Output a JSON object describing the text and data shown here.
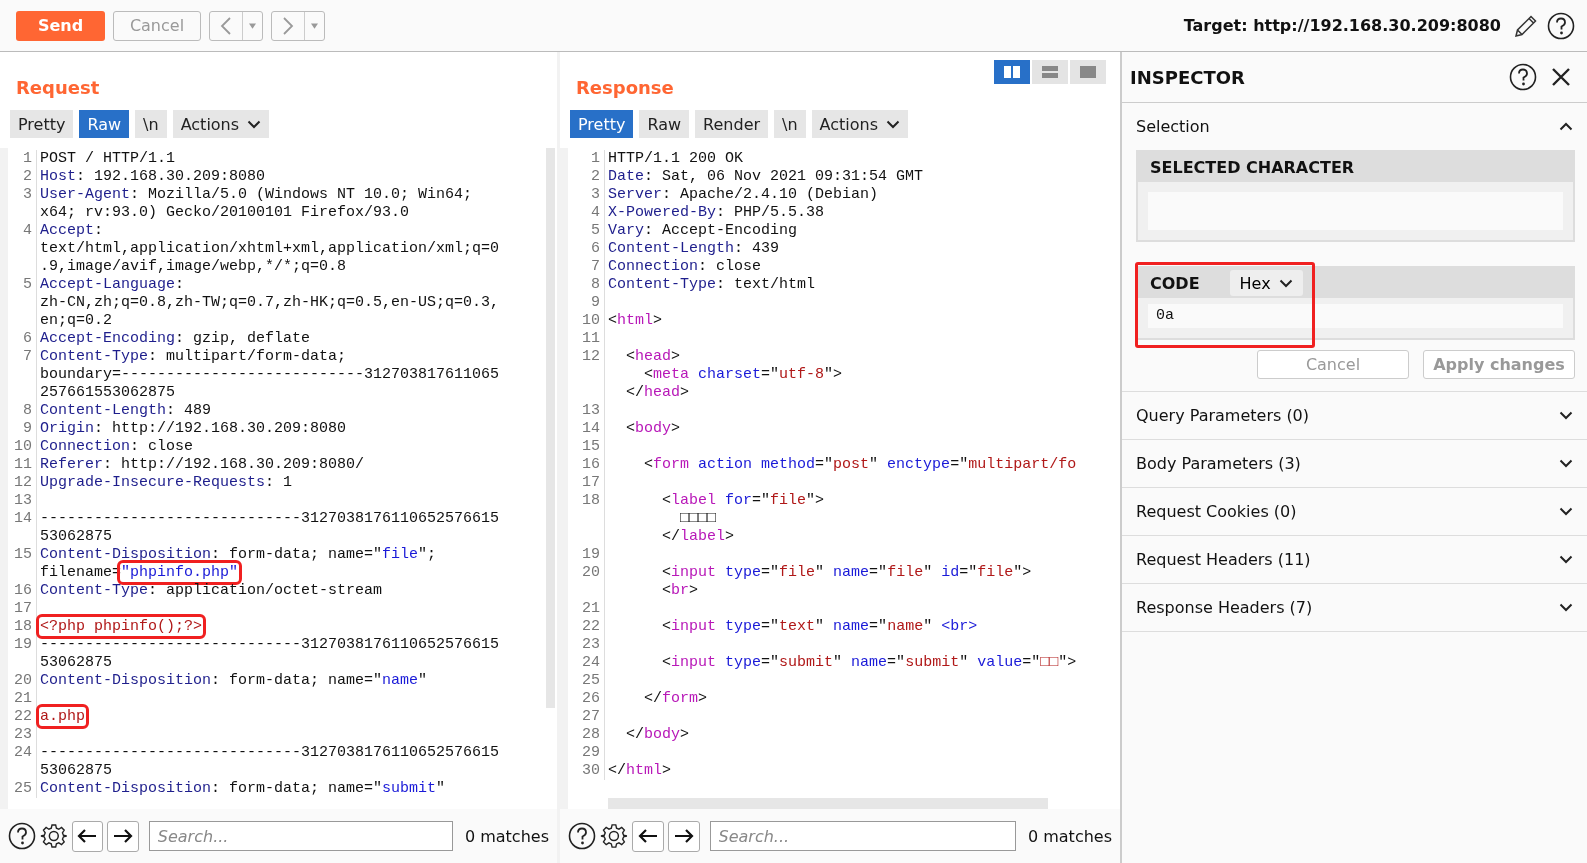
{
  "toolbar": {
    "send": "Send",
    "cancel": {
      "label": "Cancel",
      "disabled": true
    },
    "target": "Target: http://192.168.30.209:8080"
  },
  "request": {
    "title": "Request",
    "tabs": [
      {
        "label": "Pretty",
        "kind": "tab",
        "selected": false
      },
      {
        "label": "Raw",
        "kind": "tab",
        "selected": true
      },
      {
        "label": "\\n",
        "kind": "tab",
        "selected": false
      },
      {
        "label": "Actions",
        "kind": "menu",
        "selected": false
      }
    ],
    "lines": [
      {
        "num": "1",
        "rows": [
          [
            {
              "text": "POST / HTTP/1.1",
              "kind": "p"
            }
          ]
        ]
      },
      {
        "num": "2",
        "rows": [
          [
            {
              "text": "Host",
              "kind": "k"
            },
            {
              "text": ": 192.168.30.209:8080",
              "kind": "p"
            }
          ]
        ]
      },
      {
        "num": "3",
        "rows": [
          [
            {
              "text": "User-Agent",
              "kind": "k"
            },
            {
              "text": ": Mozilla/5.0 (Windows NT 10.0; Win64;",
              "kind": "p"
            }
          ],
          [
            {
              "text": "x64; rv:93.0) Gecko/20100101 Firefox/93.0",
              "kind": "p"
            }
          ]
        ]
      },
      {
        "num": "4",
        "rows": [
          [
            {
              "text": "Accept",
              "kind": "k"
            },
            {
              "text": ":",
              "kind": "p"
            }
          ],
          [
            {
              "text": "text/html,application/xhtml+xml,application/xml;q=0",
              "kind": "p"
            }
          ],
          [
            {
              "text": ".9,image/avif,image/webp,*/*;q=0.8",
              "kind": "p"
            }
          ]
        ]
      },
      {
        "num": "5",
        "rows": [
          [
            {
              "text": "Accept-Language",
              "kind": "k"
            },
            {
              "text": ":",
              "kind": "p"
            }
          ],
          [
            {
              "text": "zh-CN,zh;q=0.8,zh-TW;q=0.7,zh-HK;q=0.5,en-US;q=0.3,",
              "kind": "p"
            }
          ],
          [
            {
              "text": "en;q=0.2",
              "kind": "p"
            }
          ]
        ]
      },
      {
        "num": "6",
        "rows": [
          [
            {
              "text": "Accept-Encoding",
              "kind": "k"
            },
            {
              "text": ": gzip, deflate",
              "kind": "p"
            }
          ]
        ]
      },
      {
        "num": "7",
        "rows": [
          [
            {
              "text": "Content-Type",
              "kind": "k"
            },
            {
              "text": ": multipart/form-data;",
              "kind": "p"
            }
          ],
          [
            {
              "text": "boundary=---------------------------312703817611065",
              "kind": "p"
            }
          ],
          [
            {
              "text": "257661553062875",
              "kind": "p"
            }
          ]
        ]
      },
      {
        "num": "8",
        "rows": [
          [
            {
              "text": "Content-Length",
              "kind": "k"
            },
            {
              "text": ": 489",
              "kind": "p"
            }
          ]
        ]
      },
      {
        "num": "9",
        "rows": [
          [
            {
              "text": "Origin",
              "kind": "k"
            },
            {
              "text": ": http://192.168.30.209:8080",
              "kind": "p"
            }
          ]
        ]
      },
      {
        "num": "10",
        "rows": [
          [
            {
              "text": "Connection",
              "kind": "k"
            },
            {
              "text": ": close",
              "kind": "p"
            }
          ]
        ]
      },
      {
        "num": "11",
        "rows": [
          [
            {
              "text": "Referer",
              "kind": "k"
            },
            {
              "text": ": http://192.168.30.209:8080/",
              "kind": "p"
            }
          ]
        ]
      },
      {
        "num": "12",
        "rows": [
          [
            {
              "text": "Upgrade-Insecure-Requests",
              "kind": "k"
            },
            {
              "text": ": 1",
              "kind": "p"
            }
          ]
        ]
      },
      {
        "num": "13",
        "rows": [
          []
        ]
      },
      {
        "num": "14",
        "rows": [
          [
            {
              "text": "-----------------------------3127038176110652576615",
              "kind": "p"
            }
          ],
          [
            {
              "text": "53062875",
              "kind": "p"
            }
          ]
        ]
      },
      {
        "num": "15",
        "rows": [
          [
            {
              "text": "Content-Disposition",
              "kind": "k"
            },
            {
              "text": ": form-data; name=\"",
              "kind": "p"
            },
            {
              "text": "file",
              "kind": "a"
            },
            {
              "text": "\";",
              "kind": "p"
            }
          ],
          [
            {
              "text": "filename=",
              "kind": "p"
            },
            {
              "text": "\"phpinfo.php\"",
              "kind": "a",
              "boxed": true
            }
          ]
        ]
      },
      {
        "num": "16",
        "rows": [
          [
            {
              "text": "Content-Type",
              "kind": "k"
            },
            {
              "text": ": application/octet-stream",
              "kind": "p"
            }
          ]
        ]
      },
      {
        "num": "17",
        "rows": [
          []
        ]
      },
      {
        "num": "18",
        "rows": [
          [
            {
              "text": "<?php phpinfo();?>",
              "kind": "v",
              "boxed": true
            }
          ]
        ]
      },
      {
        "num": "19",
        "rows": [
          [
            {
              "text": "-----------------------------3127038176110652576615",
              "kind": "p"
            }
          ],
          [
            {
              "text": "53062875",
              "kind": "p"
            }
          ]
        ]
      },
      {
        "num": "20",
        "rows": [
          [
            {
              "text": "Content-Disposition",
              "kind": "k"
            },
            {
              "text": ": form-data; name=\"",
              "kind": "p"
            },
            {
              "text": "name",
              "kind": "a"
            },
            {
              "text": "\"",
              "kind": "p"
            }
          ]
        ]
      },
      {
        "num": "21",
        "rows": [
          []
        ]
      },
      {
        "num": "22",
        "rows": [
          [
            {
              "text": "a.php",
              "kind": "v",
              "boxed": true
            }
          ]
        ]
      },
      {
        "num": "23",
        "rows": [
          []
        ]
      },
      {
        "num": "24",
        "rows": [
          [
            {
              "text": "-----------------------------3127038176110652576615",
              "kind": "p"
            }
          ],
          [
            {
              "text": "53062875",
              "kind": "p"
            }
          ]
        ]
      },
      {
        "num": "25",
        "rows": [
          [
            {
              "text": "Content-Disposition",
              "kind": "k"
            },
            {
              "text": ": form-data; name=\"",
              "kind": "p"
            },
            {
              "text": "submit",
              "kind": "a"
            },
            {
              "text": "\"",
              "kind": "p"
            }
          ]
        ]
      }
    ],
    "search": {
      "placeholder": "Search...",
      "matches": "0 matches"
    }
  },
  "response": {
    "title": "Response",
    "layout_buttons": [
      {
        "kind": "columns",
        "selected": true
      },
      {
        "kind": "rows",
        "selected": false
      },
      {
        "kind": "single",
        "selected": false
      }
    ],
    "tabs": [
      {
        "label": "Pretty",
        "kind": "tab",
        "selected": true
      },
      {
        "label": "Raw",
        "kind": "tab",
        "selected": false
      },
      {
        "label": "Render",
        "kind": "tab",
        "selected": false
      },
      {
        "label": "\\n",
        "kind": "tab",
        "selected": false
      },
      {
        "label": "Actions",
        "kind": "menu",
        "selected": false
      }
    ],
    "lines": [
      {
        "num": "1",
        "rows": [
          [
            {
              "text": "HTTP/1.1 200 OK",
              "kind": "p"
            }
          ]
        ]
      },
      {
        "num": "2",
        "rows": [
          [
            {
              "text": "Date",
              "kind": "k"
            },
            {
              "text": ": Sat, 06 Nov 2021 09:31:54 GMT",
              "kind": "p"
            }
          ]
        ]
      },
      {
        "num": "3",
        "rows": [
          [
            {
              "text": "Server",
              "kind": "k"
            },
            {
              "text": ": Apache/2.4.10 (Debian)",
              "kind": "p"
            }
          ]
        ]
      },
      {
        "num": "4",
        "rows": [
          [
            {
              "text": "X-Powered-By",
              "kind": "k"
            },
            {
              "text": ": PHP/5.5.38",
              "kind": "p"
            }
          ]
        ]
      },
      {
        "num": "5",
        "rows": [
          [
            {
              "text": "Vary",
              "kind": "k"
            },
            {
              "text": ": Accept-Encoding",
              "kind": "p"
            }
          ]
        ]
      },
      {
        "num": "6",
        "rows": [
          [
            {
              "text": "Content-Length",
              "kind": "k"
            },
            {
              "text": ": 439",
              "kind": "p"
            }
          ]
        ]
      },
      {
        "num": "7",
        "rows": [
          [
            {
              "text": "Connection",
              "kind": "k"
            },
            {
              "text": ": close",
              "kind": "p"
            }
          ]
        ]
      },
      {
        "num": "8",
        "rows": [
          [
            {
              "text": "Content-Type",
              "kind": "k"
            },
            {
              "text": ": text/html",
              "kind": "p"
            }
          ]
        ]
      },
      {
        "num": "9",
        "rows": [
          []
        ]
      },
      {
        "num": "10",
        "rows": [
          [
            {
              "text": "<",
              "kind": "p"
            },
            {
              "text": "html",
              "kind": "t"
            },
            {
              "text": ">",
              "kind": "p"
            }
          ]
        ]
      },
      {
        "num": "11",
        "rows": [
          []
        ]
      },
      {
        "num": "12",
        "rows": [
          {
            "spans": [
              {
                "text": "  <",
                "kind": "p"
              },
              {
                "text": "head",
                "kind": "t"
              },
              {
                "text": ">",
                "kind": "p"
              }
            ]
          },
          {
            "spans": [
              {
                "text": "    <",
                "kind": "p"
              },
              {
                "text": "meta ",
                "kind": "t"
              },
              {
                "text": "charset",
                "kind": "a"
              },
              {
                "text": "=\"",
                "kind": "p"
              },
              {
                "text": "utf-8",
                "kind": "v"
              },
              {
                "text": "\">",
                "kind": "p"
              }
            ]
          },
          {
            "spans": [
              {
                "text": "  </",
                "kind": "p"
              },
              {
                "text": "head",
                "kind": "t"
              },
              {
                "text": ">",
                "kind": "p"
              }
            ]
          }
        ]
      },
      {
        "num": "13",
        "rows": [
          []
        ]
      },
      {
        "num": "14",
        "rows": [
          [
            {
              "text": "  <",
              "kind": "p"
            },
            {
              "text": "body",
              "kind": "t"
            },
            {
              "text": ">",
              "kind": "p"
            }
          ]
        ]
      },
      {
        "num": "15",
        "rows": [
          []
        ]
      },
      {
        "num": "16",
        "rows": [
          [
            {
              "text": "    <",
              "kind": "p"
            },
            {
              "text": "form ",
              "kind": "t"
            },
            {
              "text": "action ",
              "kind": "a"
            },
            {
              "text": "method",
              "kind": "a"
            },
            {
              "text": "=\"",
              "kind": "p"
            },
            {
              "text": "post",
              "kind": "v"
            },
            {
              "text": "\" ",
              "kind": "p"
            },
            {
              "text": "enctype",
              "kind": "a"
            },
            {
              "text": "=\"",
              "kind": "p"
            },
            {
              "text": "multipart/fo",
              "kind": "v"
            }
          ]
        ]
      },
      {
        "num": "17",
        "rows": [
          []
        ]
      },
      {
        "num": "18",
        "rows": [
          {
            "spans": [
              {
                "text": "      <",
                "kind": "p"
              },
              {
                "text": "label ",
                "kind": "t"
              },
              {
                "text": "for",
                "kind": "a"
              },
              {
                "text": "=\"",
                "kind": "p"
              },
              {
                "text": "file",
                "kind": "v"
              },
              {
                "text": "\">",
                "kind": "p"
              }
            ]
          },
          {
            "spans": [
              {
                "text": "        □□□□",
                "kind": "p"
              }
            ]
          },
          {
            "spans": [
              {
                "text": "      </",
                "kind": "p"
              },
              {
                "text": "label",
                "kind": "t"
              },
              {
                "text": ">",
                "kind": "p"
              }
            ]
          }
        ]
      },
      {
        "num": "19",
        "rows": [
          []
        ]
      },
      {
        "num": "20",
        "rows": [
          {
            "spans": [
              {
                "text": "      <",
                "kind": "p"
              },
              {
                "text": "input ",
                "kind": "t"
              },
              {
                "text": "type",
                "kind": "a"
              },
              {
                "text": "=\"",
                "kind": "p"
              },
              {
                "text": "file",
                "kind": "v"
              },
              {
                "text": "\" ",
                "kind": "p"
              },
              {
                "text": "name",
                "kind": "a"
              },
              {
                "text": "=\"",
                "kind": "p"
              },
              {
                "text": "file",
                "kind": "v"
              },
              {
                "text": "\" ",
                "kind": "p"
              },
              {
                "text": "id",
                "kind": "a"
              },
              {
                "text": "=\"",
                "kind": "p"
              },
              {
                "text": "file",
                "kind": "v"
              },
              {
                "text": "\">",
                "kind": "p"
              }
            ]
          },
          {
            "spans": [
              {
                "text": "      <",
                "kind": "p"
              },
              {
                "text": "br",
                "kind": "t"
              },
              {
                "text": ">",
                "kind": "p"
              }
            ]
          }
        ]
      },
      {
        "num": "21",
        "rows": [
          []
        ]
      },
      {
        "num": "22",
        "rows": [
          [
            {
              "text": "      <",
              "kind": "p"
            },
            {
              "text": "input ",
              "kind": "t"
            },
            {
              "text": "type",
              "kind": "a"
            },
            {
              "text": "=\"",
              "kind": "p"
            },
            {
              "text": "text",
              "kind": "v"
            },
            {
              "text": "\" ",
              "kind": "p"
            },
            {
              "text": "name",
              "kind": "a"
            },
            {
              "text": "=\"",
              "kind": "p"
            },
            {
              "text": "name",
              "kind": "v"
            },
            {
              "text": "\" ",
              "kind": "p"
            },
            {
              "text": "<br>",
              "kind": "a"
            }
          ]
        ]
      },
      {
        "num": "23",
        "rows": [
          []
        ]
      },
      {
        "num": "24",
        "rows": [
          [
            {
              "text": "      <",
              "kind": "p"
            },
            {
              "text": "input ",
              "kind": "t"
            },
            {
              "text": "type",
              "kind": "a"
            },
            {
              "text": "=\"",
              "kind": "p"
            },
            {
              "text": "submit",
              "kind": "v"
            },
            {
              "text": "\" ",
              "kind": "p"
            },
            {
              "text": "name",
              "kind": "a"
            },
            {
              "text": "=\"",
              "kind": "p"
            },
            {
              "text": "submit",
              "kind": "v"
            },
            {
              "text": "\" ",
              "kind": "p"
            },
            {
              "text": "value",
              "kind": "a"
            },
            {
              "text": "=\"",
              "kind": "p"
            },
            {
              "text": "□□",
              "kind": "v"
            },
            {
              "text": "\">",
              "kind": "p"
            }
          ]
        ]
      },
      {
        "num": "25",
        "rows": [
          []
        ]
      },
      {
        "num": "26",
        "rows": [
          [
            {
              "text": "    </",
              "kind": "p"
            },
            {
              "text": "form",
              "kind": "t"
            },
            {
              "text": ">",
              "kind": "p"
            }
          ]
        ]
      },
      {
        "num": "27",
        "rows": [
          []
        ]
      },
      {
        "num": "28",
        "rows": [
          [
            {
              "text": "  </",
              "kind": "p"
            },
            {
              "text": "body",
              "kind": "t"
            },
            {
              "text": ">",
              "kind": "p"
            }
          ]
        ]
      },
      {
        "num": "29",
        "rows": [
          []
        ]
      },
      {
        "num": "30",
        "rows": [
          [
            {
              "text": "</",
              "kind": "p"
            },
            {
              "text": "html",
              "kind": "t"
            },
            {
              "text": ">",
              "kind": "p"
            }
          ]
        ]
      }
    ],
    "search": {
      "placeholder": "Search...",
      "matches": "0 matches"
    }
  },
  "inspector": {
    "title": "INSPECTOR",
    "selection": {
      "label": "Selection",
      "expanded": true,
      "character_heading": "SELECTED CHARACTER",
      "code_heading": "CODE",
      "code_format": "Hex",
      "code_value": "0a",
      "code_boxed": true,
      "cancel": "Cancel",
      "apply": "Apply changes"
    },
    "sections": [
      {
        "label": "Query Parameters (0)",
        "expanded": false
      },
      {
        "label": "Body Parameters (3)",
        "expanded": false
      },
      {
        "label": "Request Cookies (0)",
        "expanded": false
      },
      {
        "label": "Request Headers (11)",
        "expanded": false
      },
      {
        "label": "Response Headers (7)",
        "expanded": false
      }
    ]
  }
}
